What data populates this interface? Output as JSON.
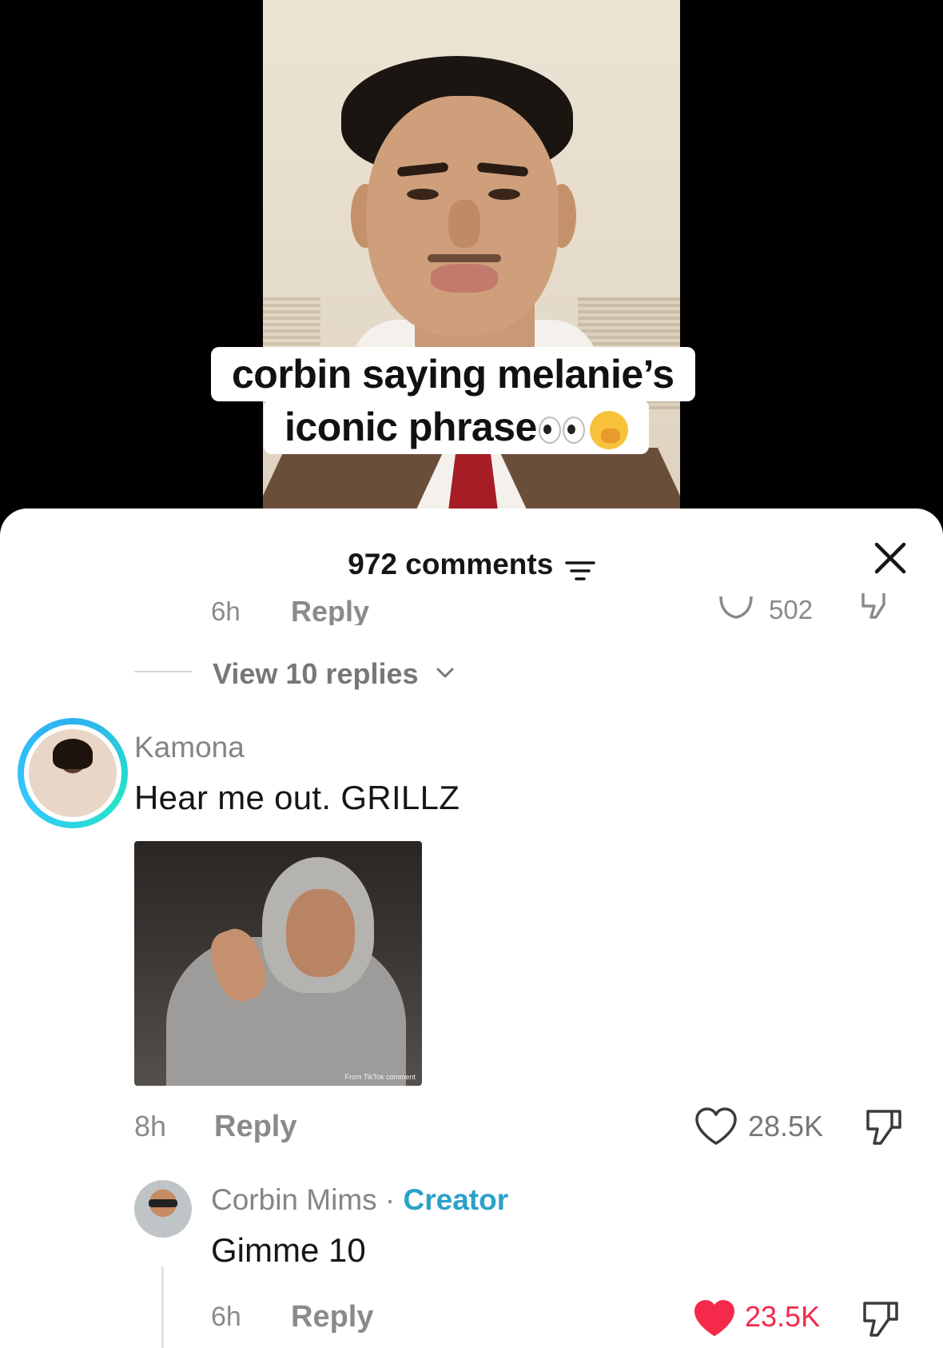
{
  "video": {
    "caption_line1": "corbin saying melanie’s",
    "caption_line2": "iconic phrase"
  },
  "comments_sheet": {
    "count_label": "972 comments",
    "previous_comment": {
      "time": "6h",
      "reply_label": "Reply",
      "likes": "502"
    },
    "view_replies": "View 10 replies",
    "comment": {
      "username": "Kamona",
      "text": "Hear me out. GRILLZ",
      "image_watermark": "From TikTok comment",
      "time": "8h",
      "reply_label": "Reply",
      "likes": "28.5K",
      "liked": false
    },
    "reply": {
      "username": "Corbin Mims",
      "separator": " · ",
      "creator_label": "Creator",
      "text": "Gimme 10",
      "time": "6h",
      "reply_label": "Reply",
      "likes": "23.5K",
      "liked": true
    }
  },
  "icons": [
    "sort-icon",
    "close-icon",
    "chevron-down-icon",
    "heart-icon",
    "dislike-icon"
  ],
  "colors": {
    "liked_heart": "#f5294a",
    "creator_tag": "#2ba1c9",
    "story_ring": "#2db0f0"
  }
}
